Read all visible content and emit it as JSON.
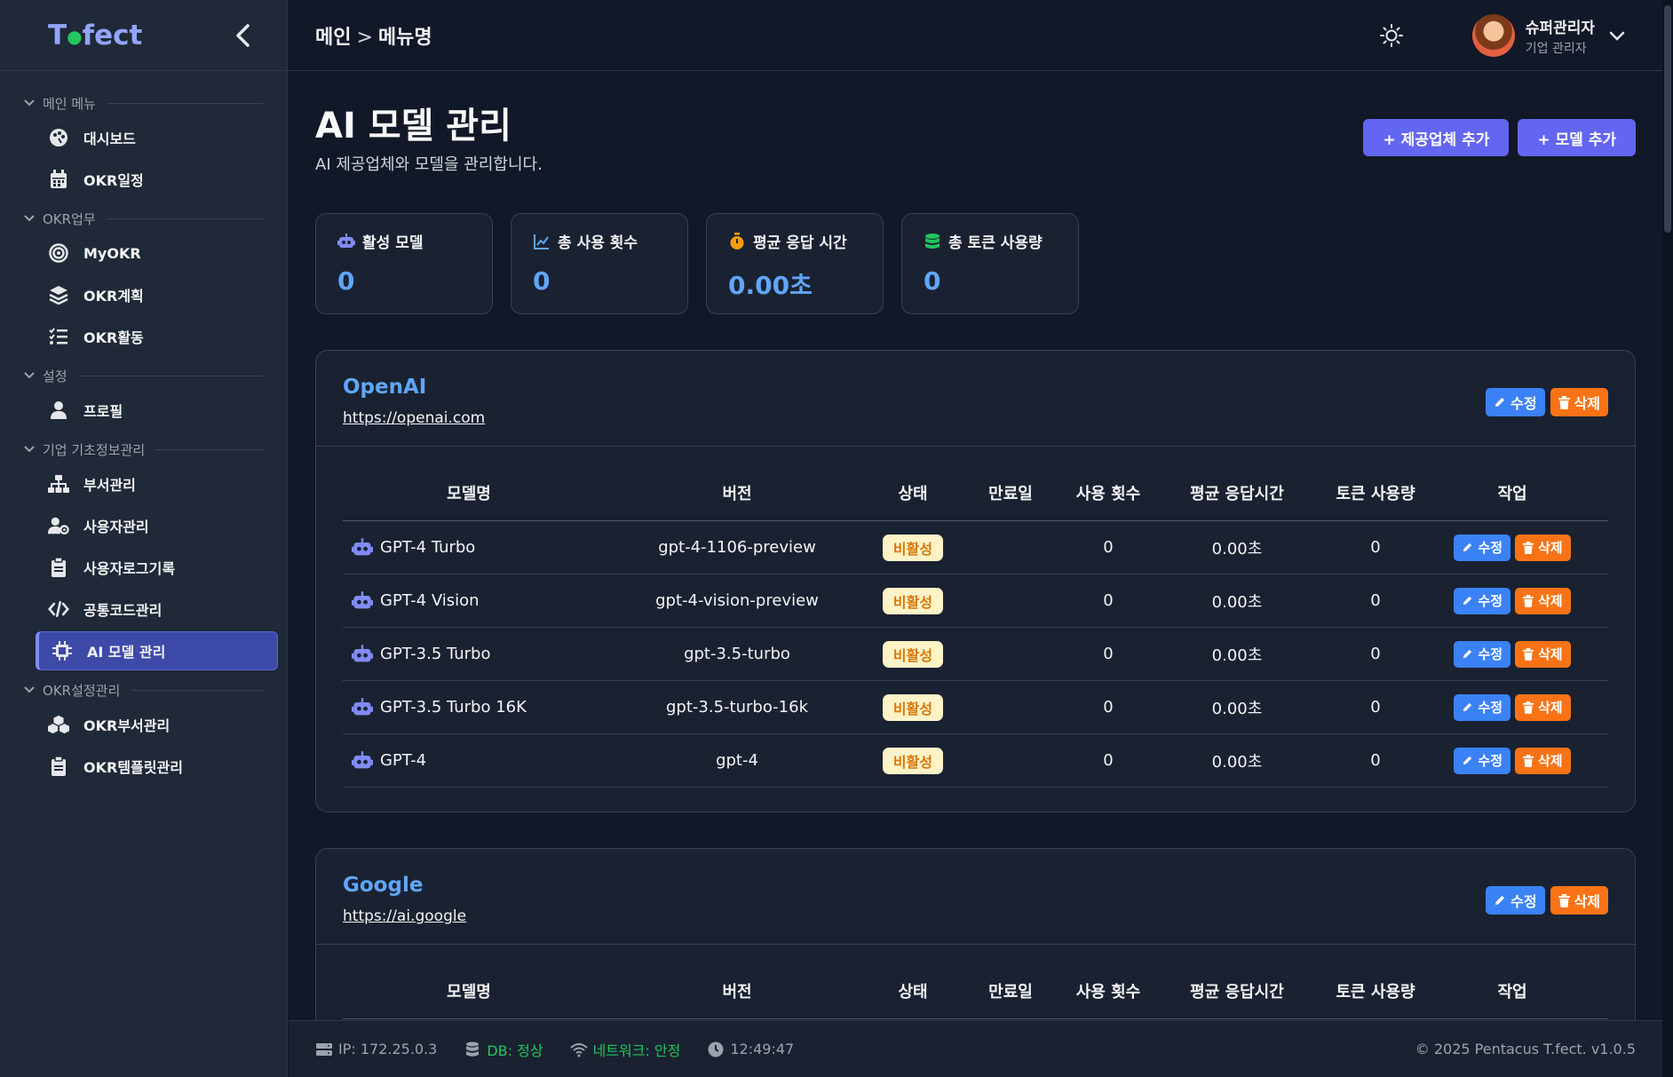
{
  "brand": {
    "logo_pre": "T",
    "logo_dot": "●",
    "logo_post": "fect"
  },
  "sidebar": {
    "sections": [
      {
        "label": "메인 메뉴",
        "items": [
          {
            "label": "대시보드",
            "icon": "palette-icon"
          },
          {
            "label": "OKR일정",
            "icon": "calendar-icon"
          }
        ]
      },
      {
        "label": "OKR업무",
        "items": [
          {
            "label": "MyOKR",
            "icon": "target-icon"
          },
          {
            "label": "OKR계획",
            "icon": "layers-icon"
          },
          {
            "label": "OKR활동",
            "icon": "list-check-icon"
          }
        ]
      },
      {
        "label": "설정",
        "items": [
          {
            "label": "프로필",
            "icon": "user-icon"
          }
        ]
      },
      {
        "label": "기업 기초정보관리",
        "items": [
          {
            "label": "부서관리",
            "icon": "sitemap-icon"
          },
          {
            "label": "사용자관리",
            "icon": "user-gear-icon"
          },
          {
            "label": "사용자로그기록",
            "icon": "clipboard-icon"
          },
          {
            "label": "공통코드관리",
            "icon": "code-icon"
          },
          {
            "label": "AI 모델 관리",
            "icon": "chip-icon"
          }
        ]
      },
      {
        "label": "OKR설정관리",
        "items": [
          {
            "label": "OKR부서관리",
            "icon": "cubes-icon"
          },
          {
            "label": "OKR템플릿관리",
            "icon": "clipboard-icon"
          }
        ]
      }
    ]
  },
  "header": {
    "crumb_main": "메인",
    "crumb_sep": ">",
    "crumb_current": "메뉴명",
    "user_name": "슈퍼관리자",
    "user_role": "기업 관리자"
  },
  "page": {
    "title": "AI 모델 관리",
    "subtitle": "AI 제공업체와 모델을 관리합니다.",
    "add_provider": "+ 제공업체 추가",
    "add_model": "+ 모델 추가"
  },
  "stats": [
    {
      "label": "활성 모델",
      "value": "0",
      "icon": "robot-icon",
      "color": "#818cf8"
    },
    {
      "label": "총 사용 횟수",
      "value": "0",
      "icon": "chart-line-icon",
      "color": "#60a5fa"
    },
    {
      "label": "평균 응답 시간",
      "value": "0.00초",
      "icon": "stopwatch-icon",
      "color": "#f59e0b"
    },
    {
      "label": "총 토큰 사용량",
      "value": "0",
      "icon": "database-icon",
      "color": "#22c55e"
    }
  ],
  "actions": {
    "edit": "수정",
    "delete": "삭제"
  },
  "columns": [
    "모델명",
    "버전",
    "상태",
    "만료일",
    "사용 횟수",
    "평균 응답시간",
    "토큰 사용량",
    "작업"
  ],
  "providers": [
    {
      "name": "OpenAI",
      "url": "https://openai.com",
      "models": [
        {
          "name": "GPT-4 Turbo",
          "version": "gpt-4-1106-preview",
          "status": "비활성",
          "expiry": "",
          "usage": "0",
          "avg_time": "0.00초",
          "tokens": "0"
        },
        {
          "name": "GPT-4 Vision",
          "version": "gpt-4-vision-preview",
          "status": "비활성",
          "expiry": "",
          "usage": "0",
          "avg_time": "0.00초",
          "tokens": "0"
        },
        {
          "name": "GPT-3.5 Turbo",
          "version": "gpt-3.5-turbo",
          "status": "비활성",
          "expiry": "",
          "usage": "0",
          "avg_time": "0.00초",
          "tokens": "0"
        },
        {
          "name": "GPT-3.5 Turbo 16K",
          "version": "gpt-3.5-turbo-16k",
          "status": "비활성",
          "expiry": "",
          "usage": "0",
          "avg_time": "0.00초",
          "tokens": "0"
        },
        {
          "name": "GPT-4",
          "version": "gpt-4",
          "status": "비활성",
          "expiry": "",
          "usage": "0",
          "avg_time": "0.00초",
          "tokens": "0"
        }
      ]
    },
    {
      "name": "Google",
      "url": "https://ai.google",
      "models": []
    }
  ],
  "footer": {
    "ip": "IP: 172.25.0.3",
    "db": "DB: 정상",
    "network": "네트워크: 안정",
    "time": "12:49:47",
    "copyright": "© 2025 Pentacus T.fect. v1.0.5"
  }
}
